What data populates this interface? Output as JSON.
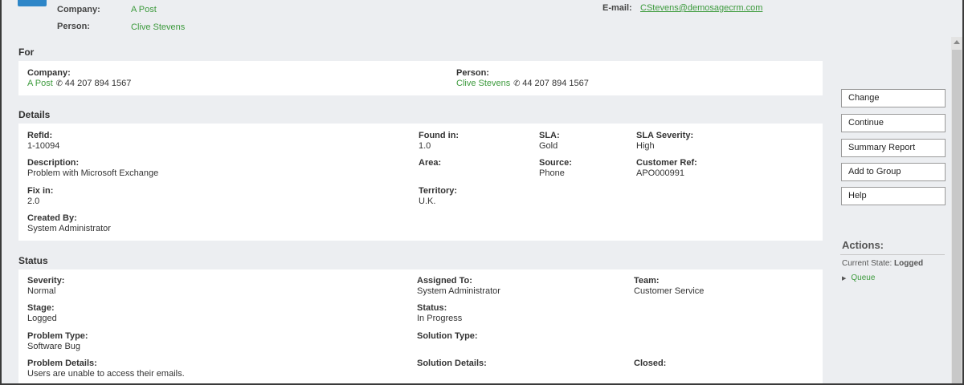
{
  "header": {
    "company_label": "Company:",
    "company_value": "A Post",
    "person_label": "Person:",
    "person_value": "Clive Stevens",
    "email_label": "E-mail:",
    "email_value": "CStevens@demosagecrm.com"
  },
  "for_section": {
    "title": "For",
    "company_label": "Company:",
    "company_value": "A Post",
    "company_phone": "44 207 894 1567",
    "person_label": "Person:",
    "person_value": "Clive Stevens",
    "person_phone": "44 207 894 1567"
  },
  "details": {
    "title": "Details",
    "refid_label": "RefId:",
    "refid_value": "1-10094",
    "found_in_label": "Found in:",
    "found_in_value": "1.0",
    "sla_label": "SLA:",
    "sla_value": "Gold",
    "sla_severity_label": "SLA Severity:",
    "sla_severity_value": "High",
    "description_label": "Description:",
    "description_value": "Problem with Microsoft Exchange",
    "area_label": "Area:",
    "source_label": "Source:",
    "source_value": "Phone",
    "customer_ref_label": "Customer Ref:",
    "customer_ref_value": "APO000991",
    "fix_in_label": "Fix in:",
    "fix_in_value": "2.0",
    "territory_label": "Territory:",
    "territory_value": "U.K.",
    "created_by_label": "Created By:",
    "created_by_value": "System Administrator"
  },
  "status": {
    "title": "Status",
    "severity_label": "Severity:",
    "severity_value": "Normal",
    "assigned_to_label": "Assigned To:",
    "assigned_to_value": "System Administrator",
    "team_label": "Team:",
    "team_value": "Customer Service",
    "stage_label": "Stage:",
    "stage_value": "Logged",
    "status_label": "Status:",
    "status_value": "In Progress",
    "problem_type_label": "Problem Type:",
    "problem_type_value": "Software Bug",
    "solution_type_label": "Solution Type:",
    "problem_details_label": "Problem Details:",
    "problem_details_value": "Users are unable to access their emails.",
    "solution_details_label": "Solution Details:",
    "closed_label": "Closed:"
  },
  "buttons": {
    "change": "Change",
    "continue": "Continue",
    "summary_report": "Summary Report",
    "add_to_group": "Add to Group",
    "help": "Help"
  },
  "actions": {
    "title": "Actions:",
    "current_state_label": "Current State:",
    "current_state_value": "Logged",
    "queue": "Queue"
  },
  "icons": {
    "phone": "phone-icon",
    "bullet": "play-bullet-icon",
    "scroll_up": "scroll-up-arrow-icon"
  },
  "colors": {
    "link_green": "#3c9a3c",
    "logo_blue": "#2e86c8",
    "background": "#eceef1"
  }
}
